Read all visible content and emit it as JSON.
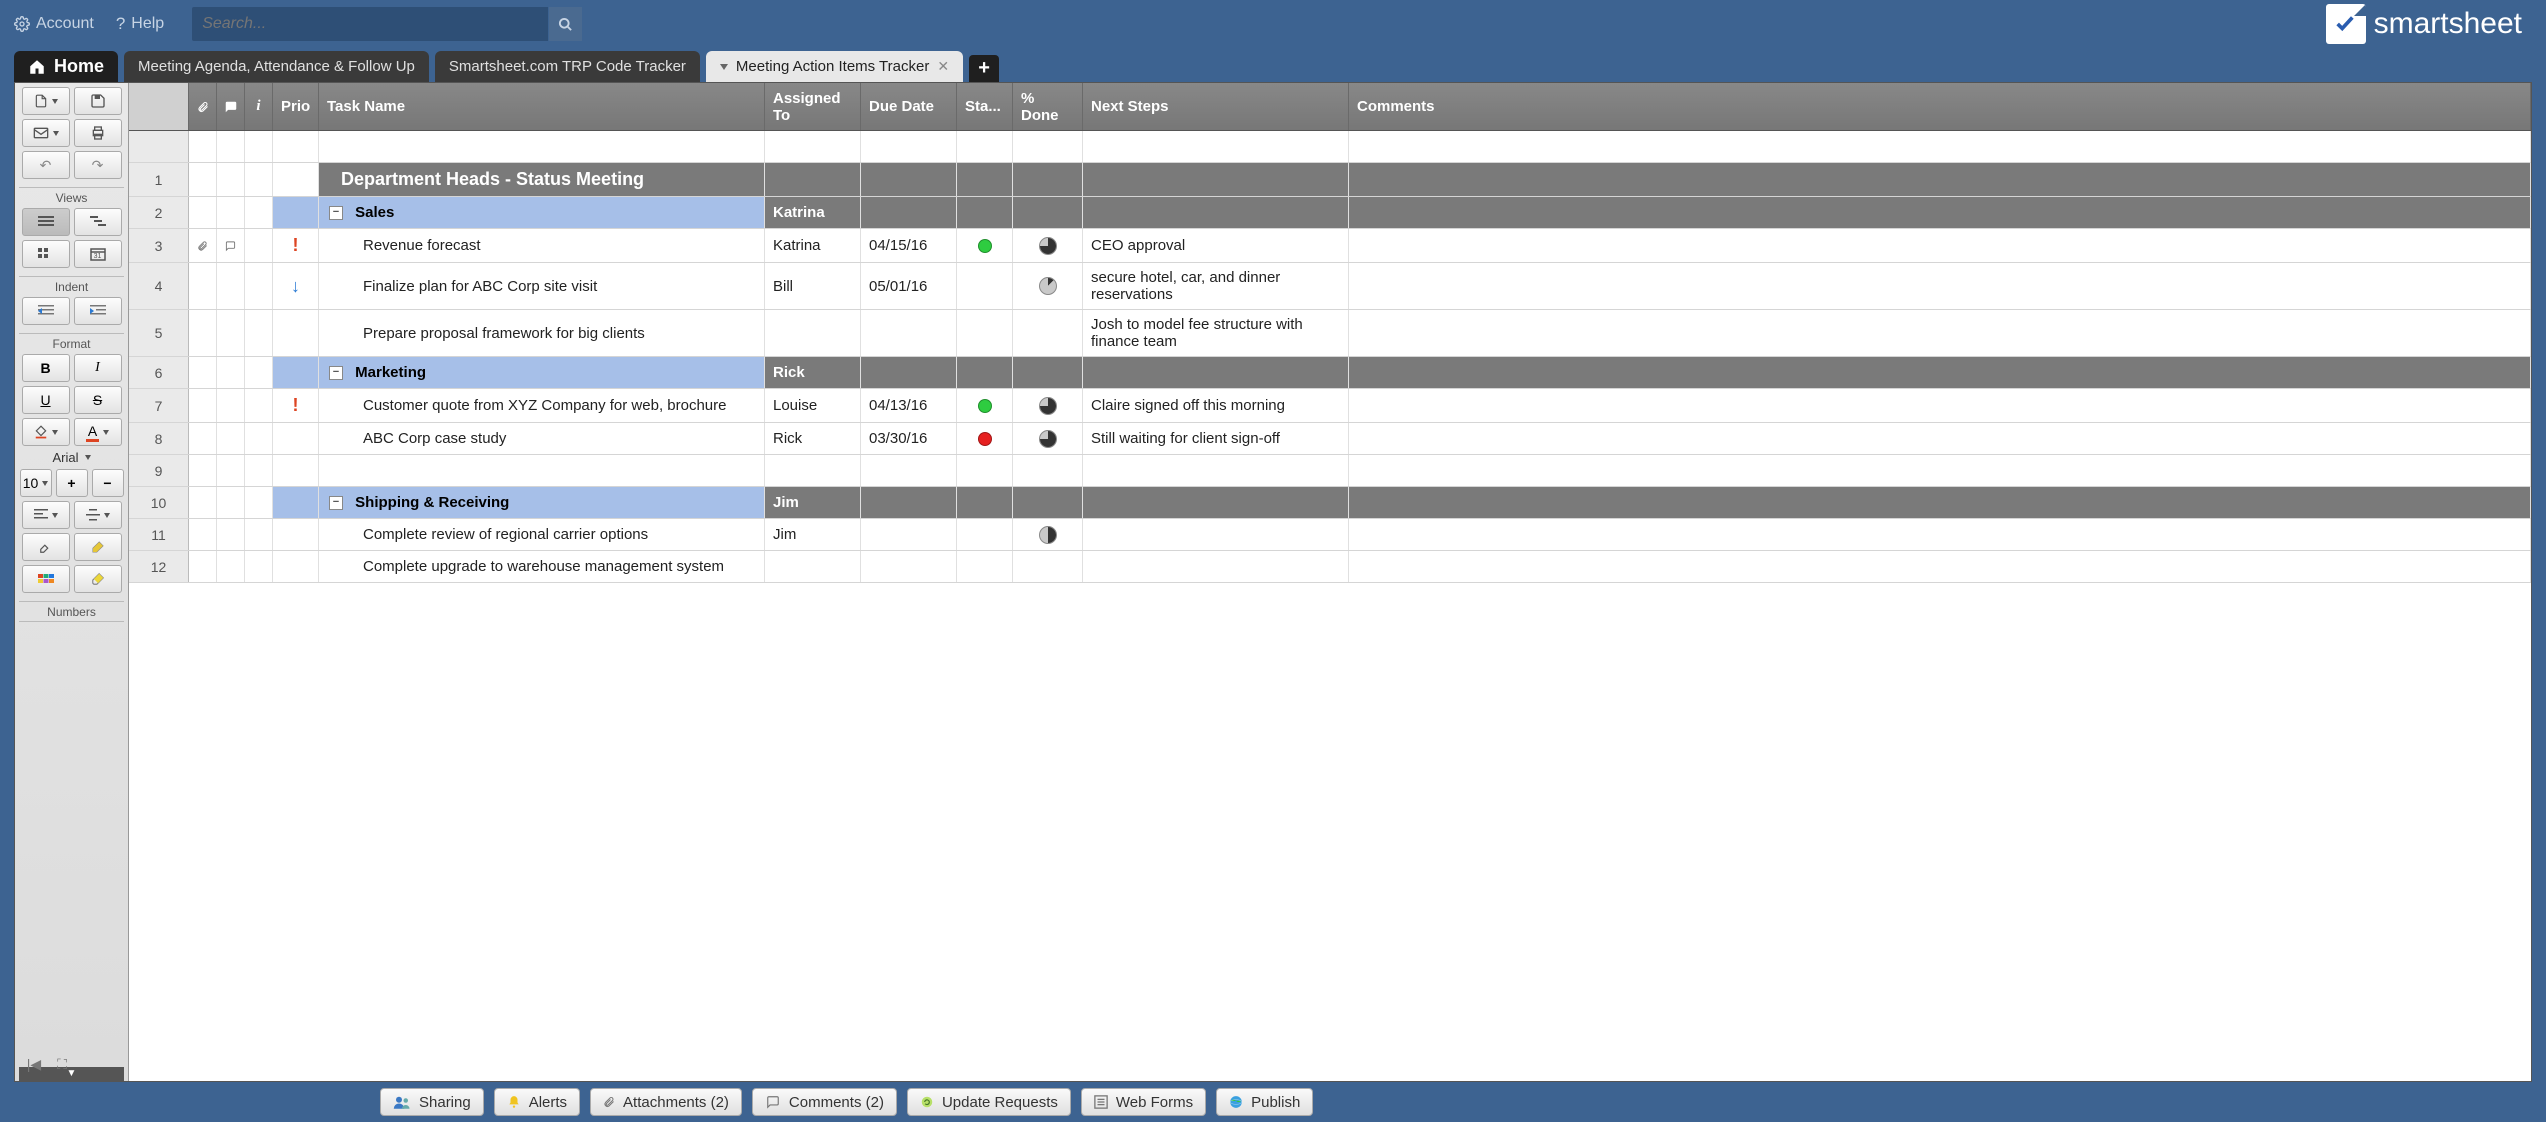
{
  "topbar": {
    "account": "Account",
    "help": "Help",
    "search_placeholder": "Search..."
  },
  "logo": "smartsheet",
  "tabs": {
    "home": "Home",
    "items": [
      {
        "label": "Meeting Agenda, Attendance & Follow Up",
        "active": false
      },
      {
        "label": "Smartsheet.com TRP Code Tracker",
        "active": false
      },
      {
        "label": "Meeting Action Items Tracker",
        "active": true
      }
    ]
  },
  "sidebar": {
    "views": "Views",
    "indent": "Indent",
    "format": "Format",
    "font": "Arial",
    "fontsize": "10",
    "numbers": "Numbers"
  },
  "columns": {
    "prio": "Prio",
    "task": "Task Name",
    "assigned": "Assigned To",
    "due": "Due Date",
    "status": "Sta...",
    "done": "% Done",
    "next": "Next Steps",
    "comments": "Comments"
  },
  "rows": [
    {
      "num": "1",
      "type": "title",
      "task": "Department Heads - Status Meeting"
    },
    {
      "num": "2",
      "type": "section",
      "task": "Sales",
      "assigned": "Katrina"
    },
    {
      "num": "3",
      "type": "item",
      "attach": true,
      "comment": true,
      "prio": "high",
      "task": "Revenue forecast",
      "assigned": "Katrina",
      "due": "04/15/16",
      "status": "#2ecc40",
      "done": 75,
      "next": "CEO approval"
    },
    {
      "num": "4",
      "type": "item",
      "prio": "low",
      "task": "Finalize plan for ABC Corp site visit",
      "assigned": "Bill",
      "due": "05/01/16",
      "done": 12,
      "next": "secure hotel, car, and dinner reservations"
    },
    {
      "num": "5",
      "type": "item",
      "task": "Prepare proposal framework for big clients",
      "next": "Josh to model fee structure with finance team"
    },
    {
      "num": "6",
      "type": "section",
      "task": "Marketing",
      "assigned": "Rick"
    },
    {
      "num": "7",
      "type": "item",
      "prio": "high",
      "task": "Customer quote from XYZ Company for web, brochure",
      "assigned": "Louise",
      "due": "04/13/16",
      "status": "#2ecc40",
      "done": 75,
      "next": "Claire signed off this morning"
    },
    {
      "num": "8",
      "type": "item",
      "task": "ABC Corp case study",
      "assigned": "Rick",
      "due": "03/30/16",
      "status": "#e62020",
      "done": 75,
      "next": "Still waiting for client sign-off"
    },
    {
      "num": "9",
      "type": "item"
    },
    {
      "num": "10",
      "type": "section",
      "task": "Shipping & Receiving",
      "assigned": "Jim"
    },
    {
      "num": "11",
      "type": "item",
      "task": "Complete review of regional carrier options",
      "assigned": "Jim",
      "done": 50
    },
    {
      "num": "12",
      "type": "item",
      "task": "Complete upgrade to warehouse management system"
    }
  ],
  "bottom": {
    "sharing": "Sharing",
    "alerts": "Alerts",
    "attachments": "Attachments  (2)",
    "comments": "Comments  (2)",
    "update": "Update Requests",
    "webforms": "Web Forms",
    "publish": "Publish"
  }
}
